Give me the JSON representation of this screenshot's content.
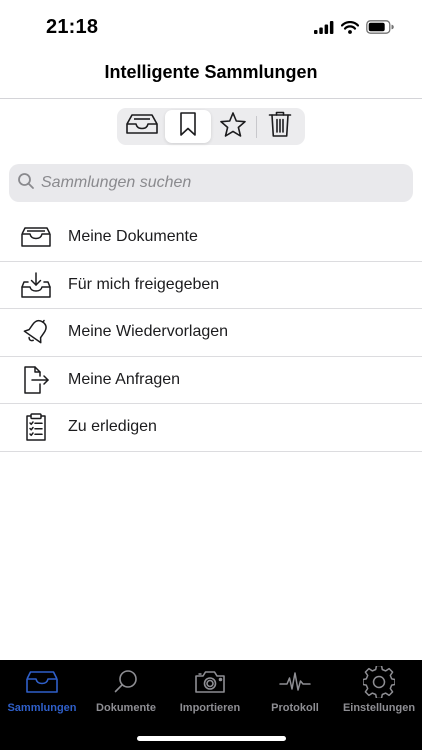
{
  "status": {
    "time": "21:18",
    "icons": [
      "signal-icon",
      "wifi-icon",
      "battery-icon"
    ]
  },
  "nav": {
    "title": "Intelligente Sammlungen"
  },
  "segments": [
    {
      "icon": "inbox-icon",
      "selected": false
    },
    {
      "icon": "bookmark-icon",
      "selected": true
    },
    {
      "icon": "star-icon",
      "selected": false
    },
    {
      "icon": "trash-icon",
      "selected": false
    }
  ],
  "search": {
    "placeholder": "Sammlungen suchen",
    "value": ""
  },
  "collections": [
    {
      "label": "Meine Dokumente",
      "icon": "tray-icon"
    },
    {
      "label": "Für mich freigegeben",
      "icon": "inbox-download-icon"
    },
    {
      "label": "Meine Wiedervorlagen",
      "icon": "bell-icon"
    },
    {
      "label": "Meine Anfragen",
      "icon": "document-export-icon"
    },
    {
      "label": "Zu erledigen",
      "icon": "clipboard-list-icon"
    }
  ],
  "tabbar": {
    "tabs": [
      {
        "label": "Sammlungen",
        "icon": "tray-icon",
        "active": true
      },
      {
        "label": "Dokumente",
        "icon": "search-icon",
        "active": false
      },
      {
        "label": "Importieren",
        "icon": "camera-icon",
        "active": false
      },
      {
        "label": "Protokoll",
        "icon": "pulse-icon",
        "active": false
      },
      {
        "label": "Einstellungen",
        "icon": "gear-icon",
        "active": false
      }
    ]
  },
  "colors": {
    "accent": "#2f5fc9",
    "tab_inactive": "#8e8e93",
    "tabbar_bg": "#000000",
    "search_bg": "#e9e9ec"
  }
}
